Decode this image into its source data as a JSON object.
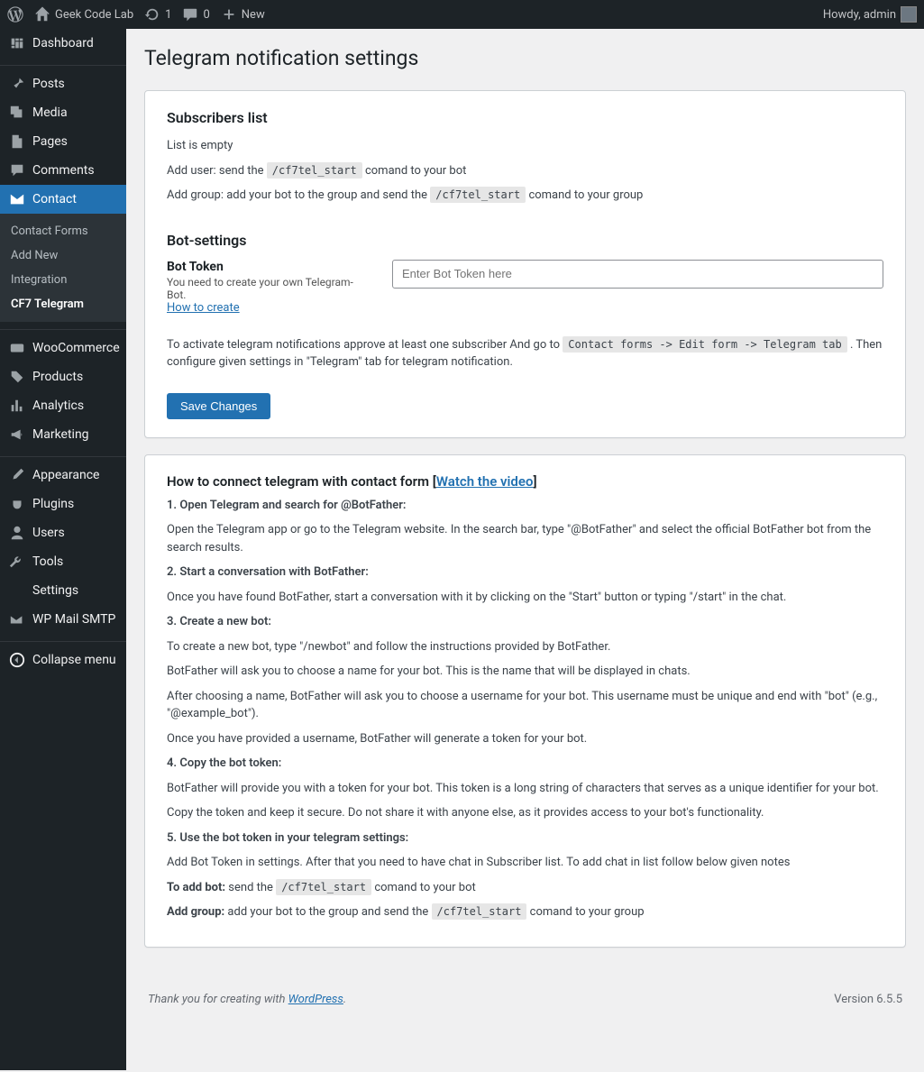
{
  "adminbar": {
    "site_name": "Geek Code Lab",
    "updates": "1",
    "comments": "0",
    "new": "New",
    "howdy": "Howdy, admin"
  },
  "sidebar": {
    "dashboard": "Dashboard",
    "posts": "Posts",
    "media": "Media",
    "pages": "Pages",
    "comments": "Comments",
    "contact": "Contact",
    "submenu": {
      "forms": "Contact Forms",
      "add_new": "Add New",
      "integration": "Integration",
      "cf7telegram": "CF7 Telegram"
    },
    "woocommerce": "WooCommerce",
    "products": "Products",
    "analytics": "Analytics",
    "marketing": "Marketing",
    "appearance": "Appearance",
    "plugins": "Plugins",
    "users": "Users",
    "tools": "Tools",
    "settings": "Settings",
    "wpmailsmtp": "WP Mail SMTP",
    "collapse": "Collapse menu"
  },
  "page": {
    "title": "Telegram notification settings",
    "sub_list_heading": "Subscribers list",
    "list_empty": "List is empty",
    "add_user_prefix": "Add user: send the ",
    "cmd_start": "/cf7tel_start",
    "add_user_suffix": " comand to your bot",
    "add_group_prefix": "Add group: add your bot to the group and send the ",
    "add_group_suffix": " comand to your group",
    "botsettings_heading": "Bot-settings",
    "bot_token_label": "Bot Token",
    "bot_token_desc": "You need to create your own Telegram-Bot.",
    "how_to_create": "How to create",
    "bot_token_placeholder": "Enter Bot Token here",
    "activate_prefix": "To activate telegram notifications approve at least one subscriber And go to ",
    "activate_code": "Contact forms -> Edit form -> Telegram tab",
    "activate_suffix": " . Then configure given settings in \"Telegram\" tab for telegram notification.",
    "save": "Save Changes"
  },
  "howto": {
    "title_prefix": "How to connect telegram with contact form [",
    "video_link": "Watch the video",
    "title_suffix": "]",
    "s1_title": "1. Open Telegram and search for @BotFather:",
    "s1_p1": "Open the Telegram app or go to the Telegram website. In the search bar, type \"@BotFather\" and select the official BotFather bot from the search results.",
    "s2_title": "2. Start a conversation with BotFather:",
    "s2_p1": "Once you have found BotFather, start a conversation with it by clicking on the \"Start\" button or typing \"/start\" in the chat.",
    "s3_title": "3. Create a new bot:",
    "s3_p1": "To create a new bot, type \"/newbot\" and follow the instructions provided by BotFather.",
    "s3_p2": "BotFather will ask you to choose a name for your bot. This is the name that will be displayed in chats.",
    "s3_p3": "After choosing a name, BotFather will ask you to choose a username for your bot. This username must be unique and end with \"bot\" (e.g., \"@example_bot\").",
    "s3_p4": "Once you have provided a username, BotFather will generate a token for your bot.",
    "s4_title": "4. Copy the bot token:",
    "s4_p1": "BotFather will provide you with a token for your bot. This token is a long string of characters that serves as a unique identifier for your bot.",
    "s4_p2": "Copy the token and keep it secure. Do not share it with anyone else, as it provides access to your bot's functionality.",
    "s5_title": "5. Use the bot token in your telegram settings:",
    "s5_p1": "Add Bot Token in settings. After that you need to have chat in Subscriber list. To add chat in list follow below given notes",
    "s5_addbot_prefix": "To add bot:",
    "s5_addbot_mid": " send the ",
    "s5_addbot_suffix": " comand to your bot",
    "s5_addgroup_prefix": "Add group:",
    "s5_addgroup_mid": " add your bot to the group and send the ",
    "s5_addgroup_suffix": " comand to your group"
  },
  "footer": {
    "thanks_prefix": "Thank you for creating with ",
    "wp": "WordPress",
    "thanks_suffix": ".",
    "version": "Version 6.5.5"
  }
}
